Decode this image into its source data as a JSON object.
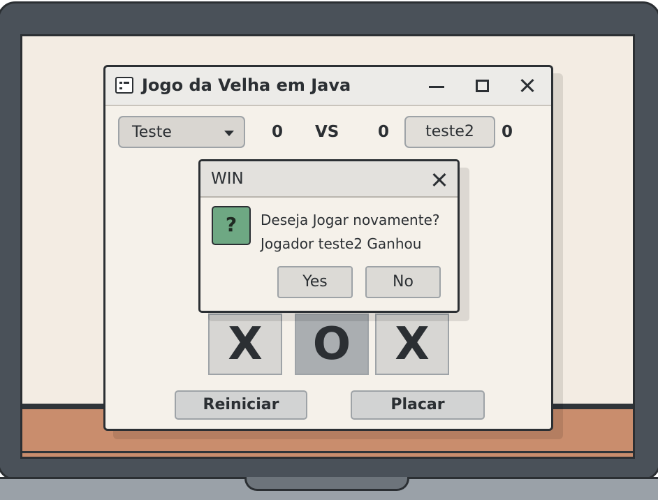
{
  "window": {
    "title": "Jogo da Velha em Java",
    "icon": "window-app-icon",
    "controls": [
      "minimize-icon",
      "maximize-icon",
      "close-icon"
    ]
  },
  "header": {
    "player1_select": "Teste",
    "player1_score": "0",
    "vs_label": "VS",
    "player2_score": "0",
    "player2_button": "teste2",
    "player2_score_right": "0"
  },
  "board": {
    "visible_cells": [
      "X",
      "O",
      "X"
    ]
  },
  "buttons": {
    "restart": "Reiniciar",
    "score": "Placar"
  },
  "dialog": {
    "title": "WIN",
    "icon": "question-icon",
    "message_line1": "Deseja Jogar novamente?",
    "message_line2": "Jogador teste2 Ganhou",
    "yes": "Yes",
    "no": "No"
  },
  "colors": {
    "frame": "#4a5159",
    "screen_bg": "#f3ece3",
    "desk": "#c98d6d",
    "window_bg": "#f5f1ea",
    "question_icon_bg": "#6ea883"
  }
}
